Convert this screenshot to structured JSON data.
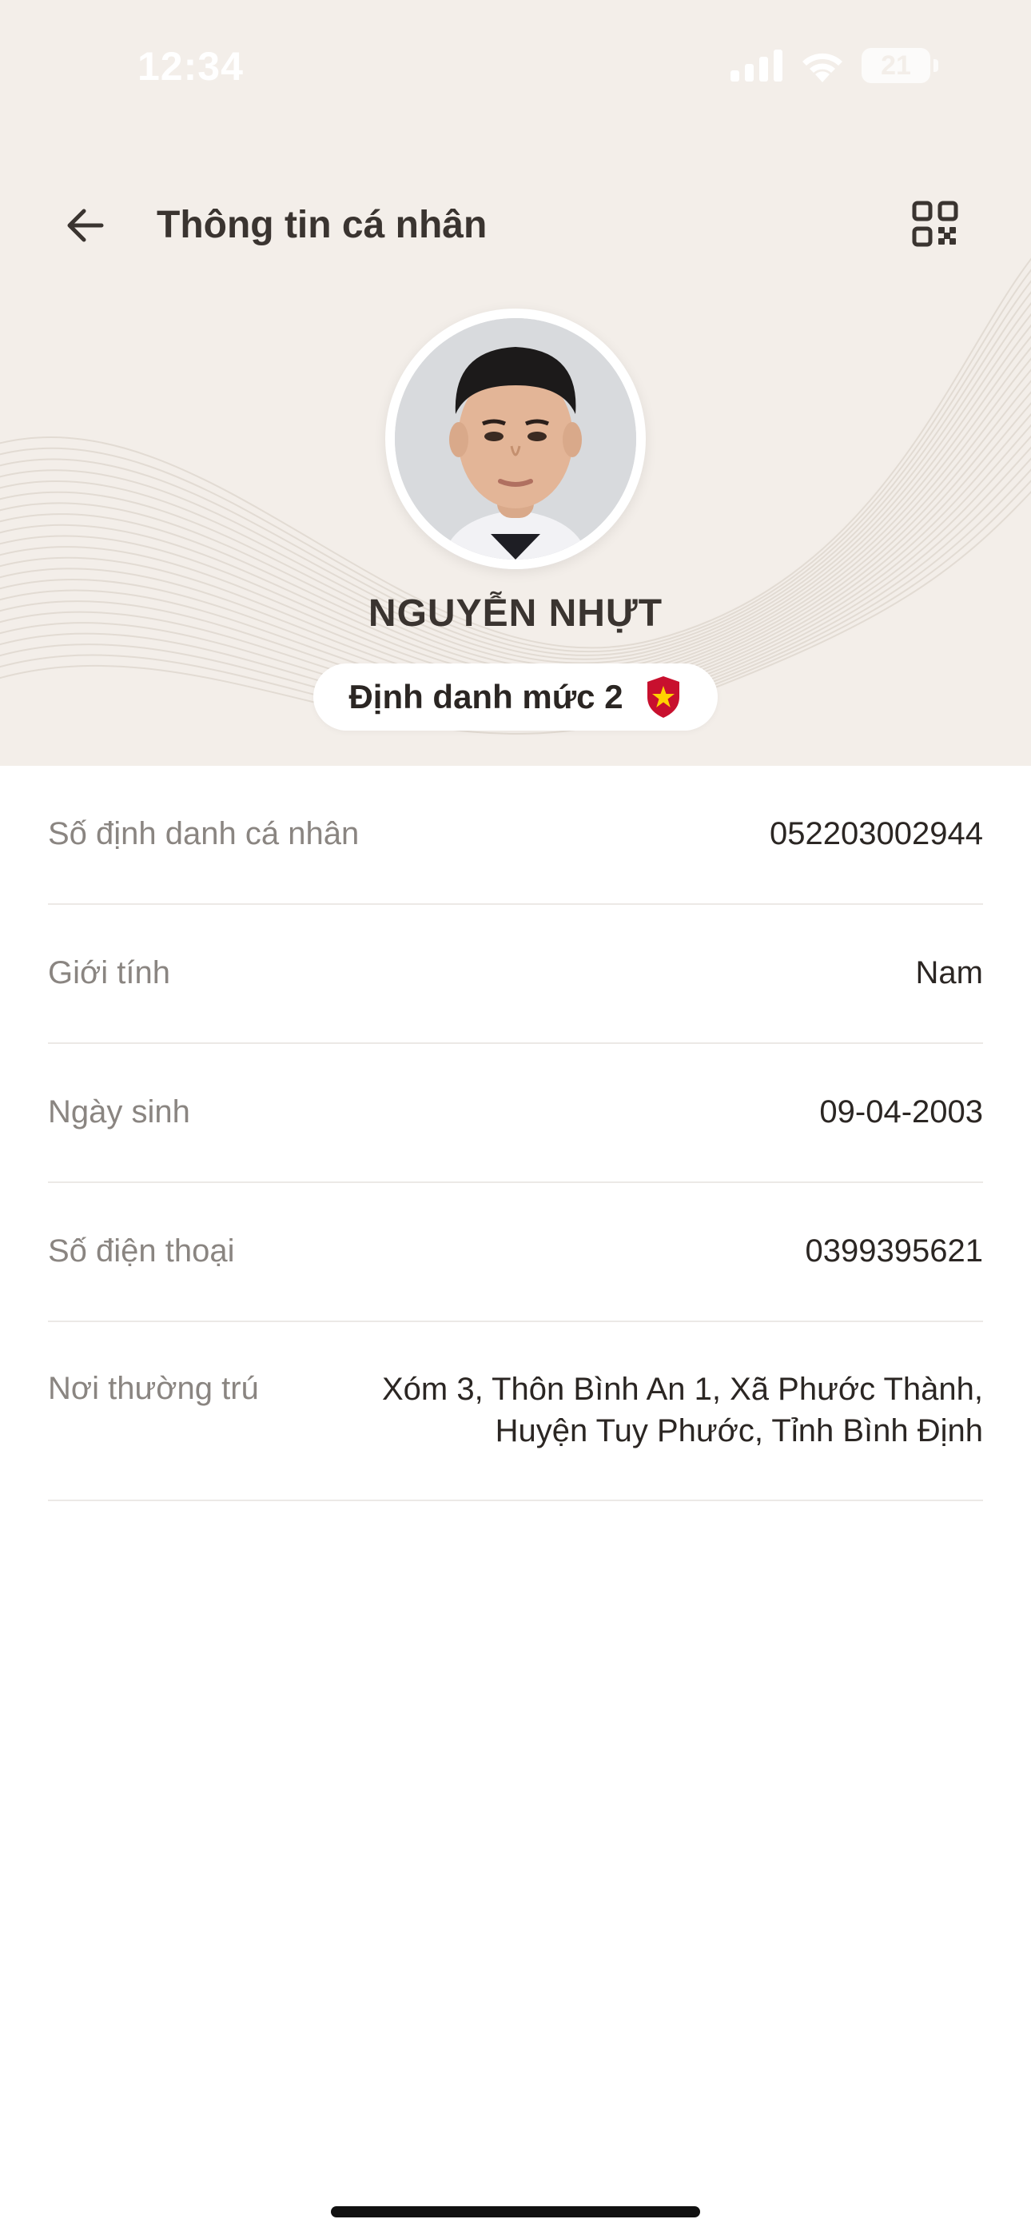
{
  "status_bar": {
    "time": "12:34",
    "battery": "21",
    "icons": [
      "signal-icon",
      "wifi-icon",
      "battery-icon"
    ]
  },
  "nav": {
    "title": "Thông tin cá nhân",
    "back_icon": "back-arrow-icon",
    "qr_icon": "qr-code-icon"
  },
  "profile": {
    "name": "NGUYỄN NHỰT",
    "level_label": "Định danh mức 2",
    "level_icon": "shield-star-icon"
  },
  "info_rows": [
    {
      "label": "Số định danh cá nhân",
      "value": "052203002944"
    },
    {
      "label": "Giới tính",
      "value": "Nam"
    },
    {
      "label": "Ngày sinh",
      "value": "09-04-2003"
    },
    {
      "label": "Số điện thoại",
      "value": "0399395621"
    },
    {
      "label": "Nơi thường trú",
      "value_lines": [
        "Xóm 3, Thôn Bình An 1, Xã Phước Thành,",
        "Huyện Tuy Phước, Tỉnh Bình Định"
      ]
    }
  ],
  "colors": {
    "header_bg": "#f3eee9",
    "title_text": "#3a3430",
    "label_text": "#8a8581",
    "value_text": "#2b2623",
    "divider": "#ece9e6",
    "shield_red": "#c8102e",
    "shield_star": "#ffd200"
  }
}
